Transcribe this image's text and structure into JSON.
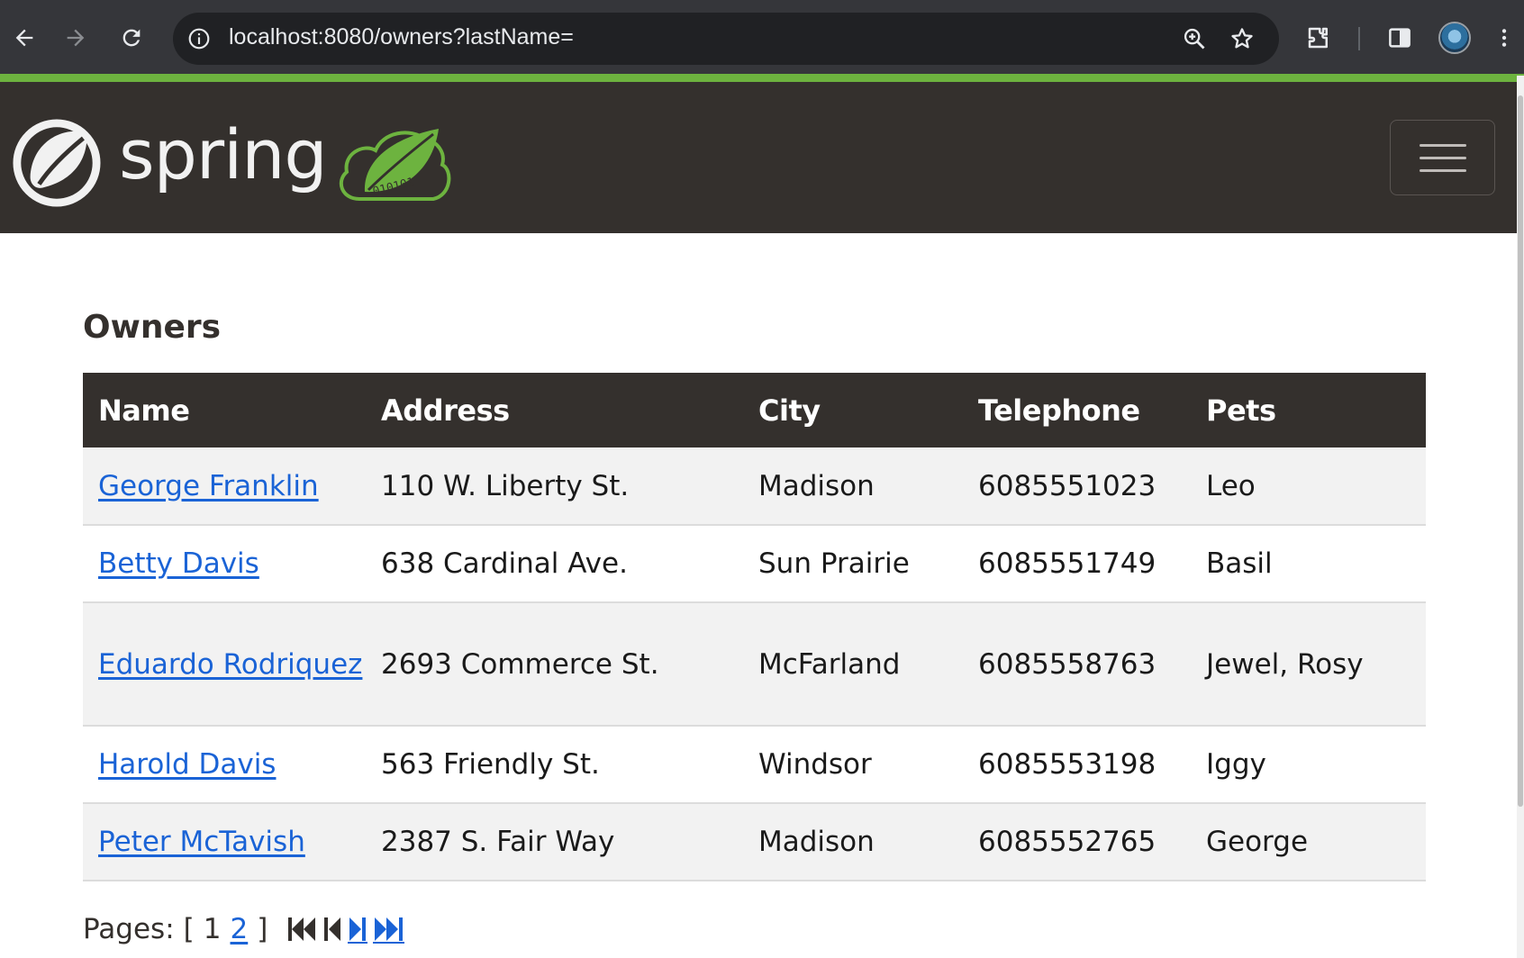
{
  "browser": {
    "url": "localhost:8080/owners?lastName="
  },
  "header": {
    "brand_text": "spring",
    "logo_binary": "010101"
  },
  "page": {
    "title": "Owners"
  },
  "table": {
    "columns": [
      "Name",
      "Address",
      "City",
      "Telephone",
      "Pets"
    ],
    "rows": [
      {
        "name": "George Franklin",
        "address": "110 W. Liberty St.",
        "city": "Madison",
        "telephone": "6085551023",
        "pets": "Leo"
      },
      {
        "name": "Betty Davis",
        "address": "638 Cardinal Ave.",
        "city": "Sun Prairie",
        "telephone": "6085551749",
        "pets": "Basil"
      },
      {
        "name": "Eduardo Rodriquez",
        "address": "2693 Commerce St.",
        "city": "McFarland",
        "telephone": "6085558763",
        "pets": "Jewel, Rosy"
      },
      {
        "name": "Harold Davis",
        "address": "563 Friendly St.",
        "city": "Windsor",
        "telephone": "6085553198",
        "pets": "Iggy"
      },
      {
        "name": "Peter McTavish",
        "address": "2387 S. Fair Way",
        "city": "Madison",
        "telephone": "6085552765",
        "pets": "George"
      }
    ]
  },
  "pagination": {
    "label": "Pages:",
    "open_bracket": "[",
    "current_page": "1",
    "next_page": "2",
    "close_bracket": "]"
  },
  "colors": {
    "spring_dark": "#34302d",
    "spring_green": "#6db33f",
    "link_blue": "#1a63d6"
  },
  "icons": {
    "back": "arrow-left-icon",
    "forward": "arrow-right-icon",
    "reload": "reload-icon",
    "site_info": "info-icon",
    "zoom": "zoom-in-icon",
    "bookmark": "star-icon",
    "extensions": "puzzle-icon",
    "side_panel": "side-panel-icon",
    "menu": "kebab-menu-icon",
    "first": "first-page-icon",
    "prev": "prev-page-icon",
    "next": "next-page-icon",
    "last": "last-page-icon"
  }
}
